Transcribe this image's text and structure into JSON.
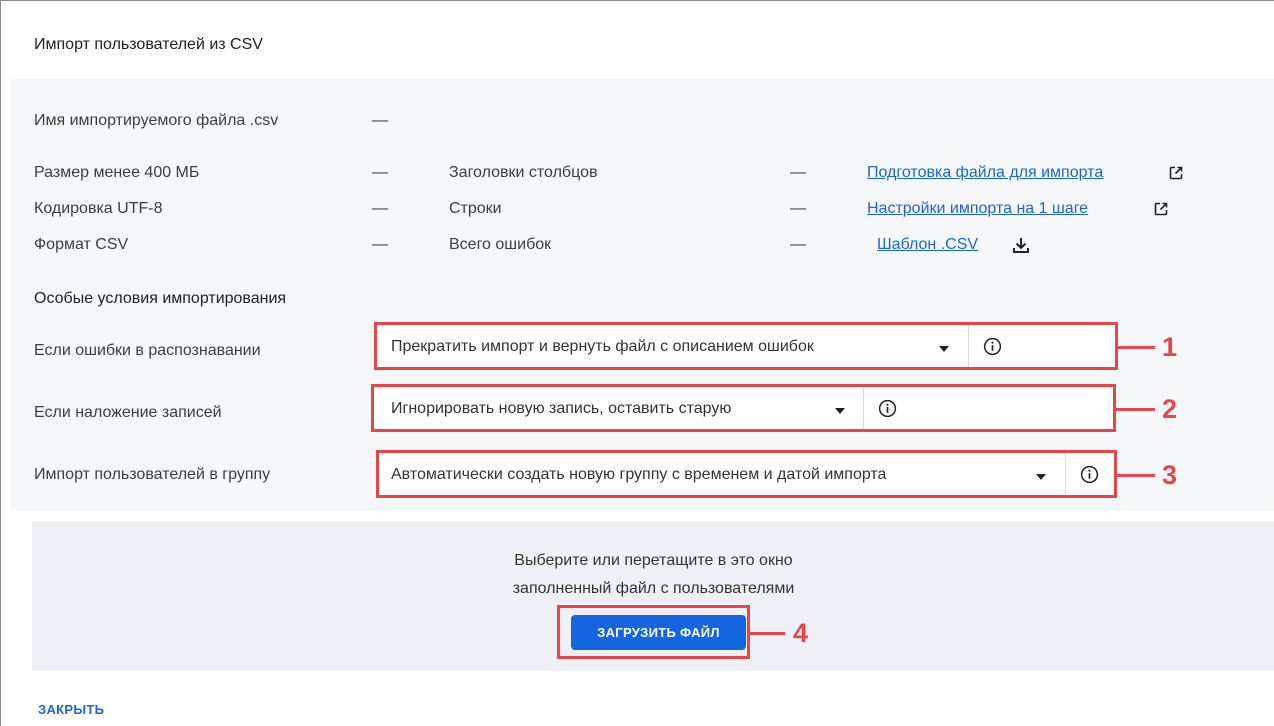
{
  "dialog": {
    "title": "Импорт пользователей из CSV"
  },
  "file_info": {
    "filename_label": "Имя импортируемого файла .csv",
    "filename_value": "—",
    "checks": [
      {
        "label": "Размер менее 400 МБ",
        "value": "—"
      },
      {
        "label": "Кодировка UTF-8",
        "value": "—"
      },
      {
        "label": "Формат CSV",
        "value": "—"
      }
    ],
    "stats": [
      {
        "label": "Заголовки столбцов",
        "value": "—"
      },
      {
        "label": "Строки",
        "value": "—"
      },
      {
        "label": "Всего ошибок",
        "value": "—"
      }
    ],
    "links": [
      {
        "label": "Подготовка файла для импорта",
        "icon": "external-link-icon"
      },
      {
        "label": "Настройки импорта на 1 шаге",
        "icon": "external-link-icon"
      },
      {
        "label": "Шаблон .CSV",
        "icon": "download-icon"
      }
    ]
  },
  "conditions": {
    "title": "Особые условия импортирования",
    "rows": [
      {
        "label": "Если ошибки в распознавании",
        "selected": "Прекратить импорт и вернуть файл с описанием ошибок",
        "callout": "1"
      },
      {
        "label": "Если наложение записей",
        "selected": "Игнорировать новую запись, оставить старую",
        "callout": "2"
      },
      {
        "label": "Импорт пользователей в группу",
        "selected": "Автоматически создать новую группу с временем и датой импорта",
        "callout": "3"
      }
    ]
  },
  "upload": {
    "hint_line1": "Выберите или перетащите в это окно",
    "hint_line2": "заполненный файл с пользователями",
    "button_label": "ЗАГРУЗИТЬ ФАЙЛ",
    "callout": "4"
  },
  "footer": {
    "close_label": "ЗАКРЫТЬ"
  },
  "colors": {
    "accent": "#1366e0",
    "link": "#1a66d8",
    "annotation": "#e8454a",
    "panel_bg": "#f6f7f9",
    "dropzone_bg": "#eef0f5"
  }
}
